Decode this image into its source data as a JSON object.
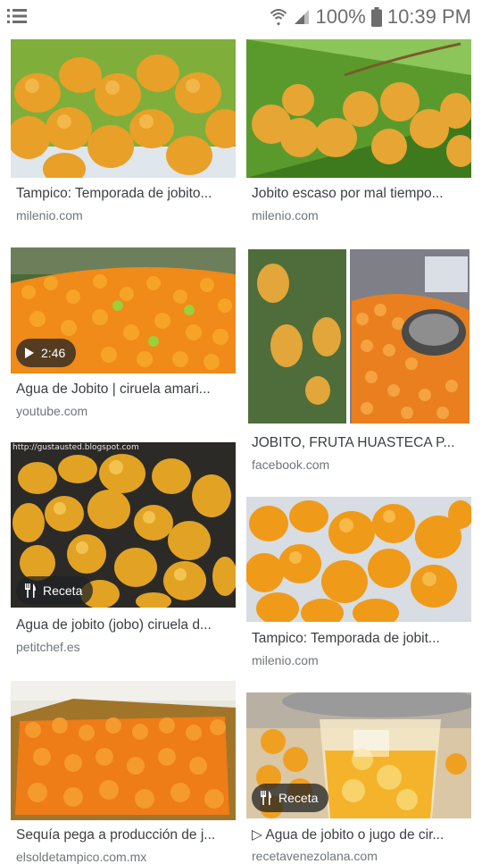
{
  "status": {
    "battery": "100%",
    "time": "10:39 PM"
  },
  "colors": {
    "text": "#3c4043",
    "source": "#70757a",
    "badge_bg": "#202124"
  },
  "results": [
    {
      "title": "Tampico: Temporada de jobito...",
      "source": "milenio.com",
      "badge": ""
    },
    {
      "title": "Jobito escaso por mal tiempo...",
      "source": "milenio.com",
      "badge": ""
    },
    {
      "title": "Agua de Jobito | ciruela amari...",
      "source": "youtube.com",
      "badge": "2:46",
      "badge_icon": "play-icon"
    },
    {
      "title": "JOBITO, FRUTA HUASTECA P...",
      "source": "facebook.com",
      "badge": ""
    },
    {
      "title": "Agua de jobito (jobo) ciruela d...",
      "source": "petitchef.es",
      "badge": "Receta",
      "badge_icon": "fork-knife-icon",
      "watermark": "http://gustausted.blogspot.com"
    },
    {
      "title": "Tampico: Temporada de jobit...",
      "source": "milenio.com",
      "badge": ""
    },
    {
      "title": "Sequía pega a producción de j...",
      "source": "elsoldetampico.com.mx",
      "badge": ""
    },
    {
      "title": "▷ Agua de jobito o jugo de cir...",
      "source": "recetavenezolana.com",
      "badge": "Receta",
      "badge_icon": "fork-knife-icon"
    }
  ]
}
